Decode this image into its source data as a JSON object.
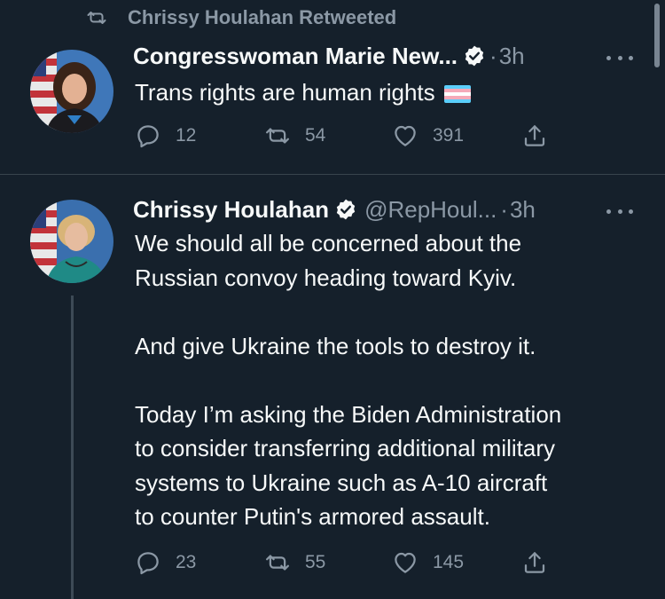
{
  "retweet_context": {
    "label": "Chrissy Houlahan Retweeted"
  },
  "tweets": [
    {
      "name": "Congresswoman Marie New...",
      "handle": "",
      "separator": "·",
      "time": "3h",
      "paragraphs": [
        "Trans rights are human rights"
      ],
      "reply_count": "12",
      "retweet_count": "54",
      "like_count": "391"
    },
    {
      "name": "Chrissy Houlahan",
      "handle": "@RepHoul...",
      "separator": "·",
      "time": "3h",
      "paragraphs": [
        [
          "We should all be concerned about the",
          "Russian convoy heading toward Kyiv."
        ],
        [
          "And give Ukraine the tools to destroy it."
        ],
        [
          "Today I’m asking the Biden Administration",
          "to consider transferring additional military",
          "systems to Ukraine such as A-10 aircraft",
          "to counter Putin's armored assault."
        ]
      ],
      "reply_count": "23",
      "retweet_count": "55",
      "like_count": "145"
    }
  ],
  "colors": {
    "background": "#15202b",
    "text": "#f7f9f9",
    "muted": "#8b98a5",
    "divider": "#38444d",
    "verified": "#f7f9f9",
    "trans_flag": [
      "#5bcefa",
      "#f5a9b8",
      "#ffffff",
      "#f5a9b8",
      "#5bcefa"
    ]
  }
}
